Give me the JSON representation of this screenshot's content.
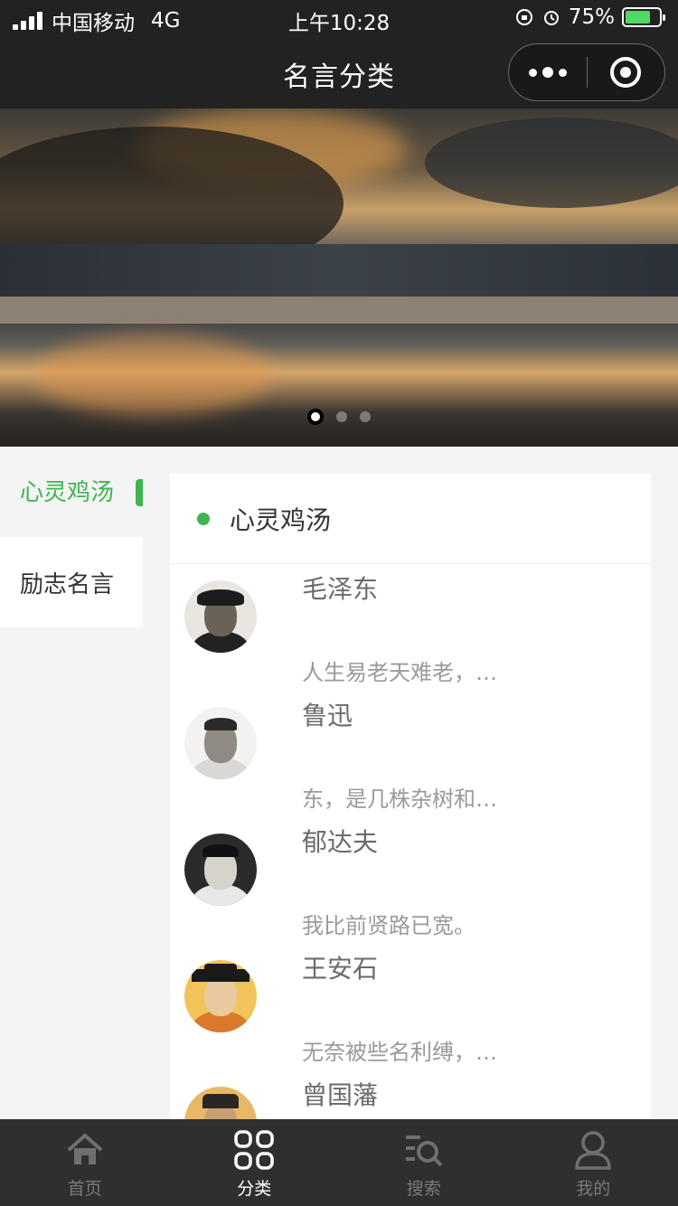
{
  "status_bar": {
    "carrier": "中国移动",
    "network": "4G",
    "time": "上午10:28",
    "battery": "75%",
    "battery_level": 0.75
  },
  "nav": {
    "title": "名言分类"
  },
  "banner": {
    "slide_count": 3,
    "active_slide": 1
  },
  "sidebar": {
    "items": [
      {
        "label": "心灵鸡汤",
        "active": true
      },
      {
        "label": "励志名言",
        "active": false
      }
    ]
  },
  "panel": {
    "title": "心灵鸡汤",
    "authors": [
      {
        "name": "毛泽东",
        "quote": "人生易老天难老，…"
      },
      {
        "name": "鲁迅",
        "quote": "东，是几株杂树和…"
      },
      {
        "name": "郁达夫",
        "quote": "我比前贤路已宽。"
      },
      {
        "name": "王安石",
        "quote": "无奈被些名利缚，…"
      },
      {
        "name": "曾国藩",
        "quote": ""
      }
    ]
  },
  "tabbar": {
    "tabs": [
      {
        "label": "首页",
        "icon": "home-icon",
        "active": false
      },
      {
        "label": "分类",
        "icon": "category-icon",
        "active": true
      },
      {
        "label": "搜索",
        "icon": "search-icon",
        "active": false
      },
      {
        "label": "我的",
        "icon": "profile-icon",
        "active": false
      }
    ]
  },
  "colors": {
    "accent": "#3db650",
    "nav_bg": "#222222",
    "tabbar_bg": "#2f2f2f"
  }
}
